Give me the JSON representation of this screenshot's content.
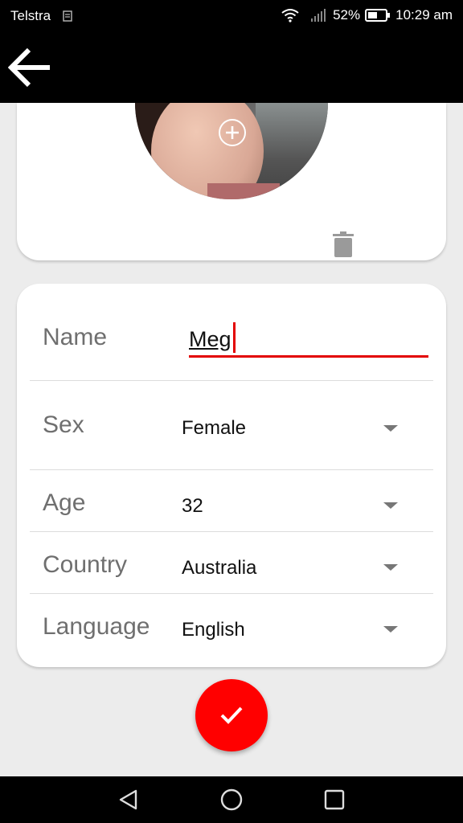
{
  "status_bar": {
    "carrier": "Telstra",
    "battery": "52%",
    "time": "10:29 am"
  },
  "app_bar": {
    "back_icon": "arrow-left-icon"
  },
  "photo": {
    "add_icon": "plus-circle-icon",
    "delete_icon": "trash-icon"
  },
  "form": {
    "name": {
      "label": "Name",
      "value": "Meg"
    },
    "sex": {
      "label": "Sex",
      "value": "Female"
    },
    "age": {
      "label": "Age",
      "value": "32"
    },
    "country": {
      "label": "Country",
      "value": "Australia"
    },
    "language": {
      "label": "Language",
      "value": "English"
    }
  },
  "fab": {
    "icon": "check-icon",
    "color": "#ff0000"
  },
  "nav_bar": {
    "back_icon": "triangle-back-icon",
    "home_icon": "circle-home-icon",
    "recents_icon": "square-recents-icon"
  },
  "colors": {
    "accent": "#e30000"
  }
}
